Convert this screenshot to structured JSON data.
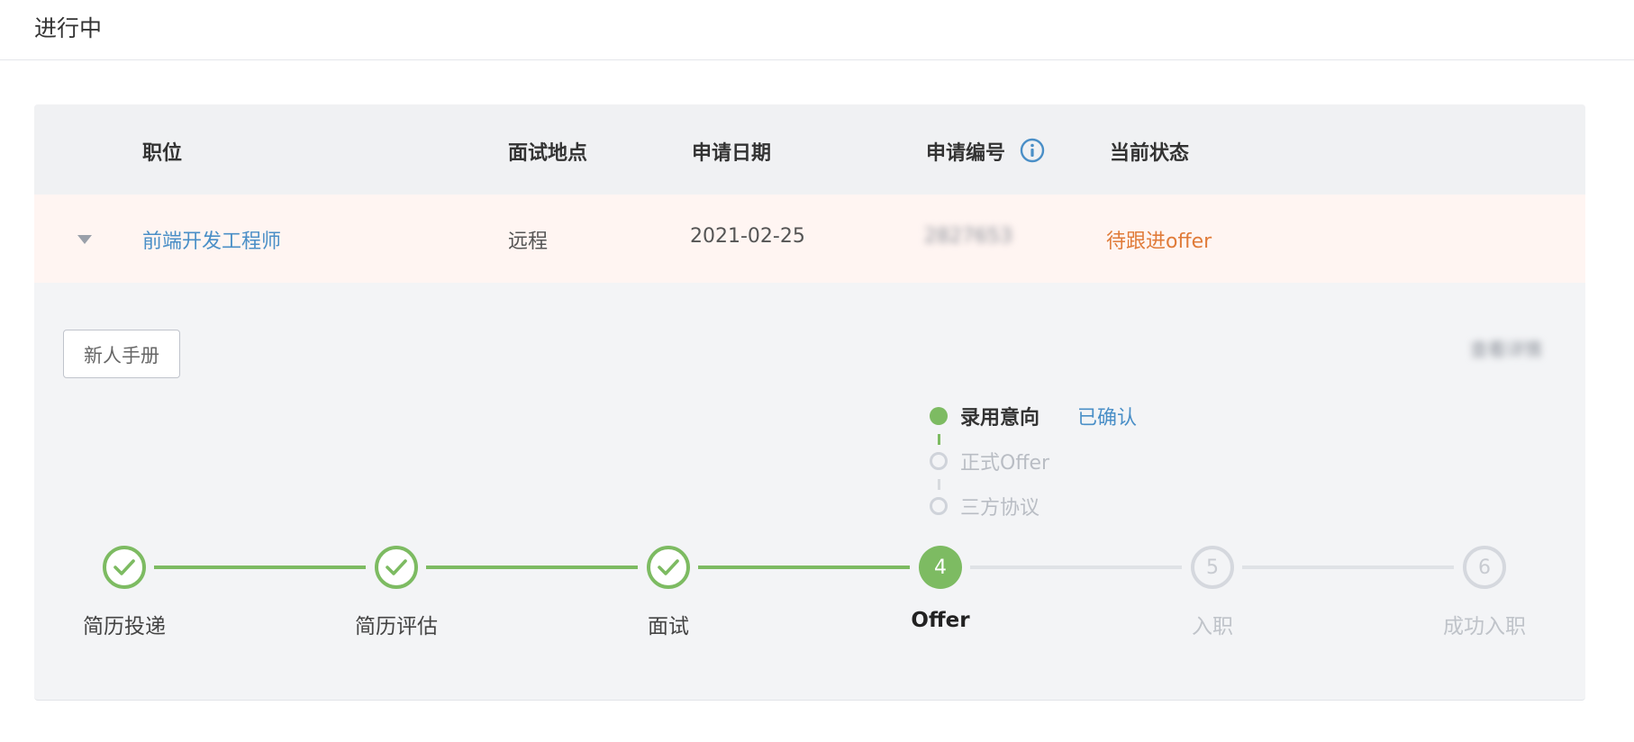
{
  "page": {
    "title": "进行中"
  },
  "table": {
    "headers": {
      "position": "职位",
      "location": "面试地点",
      "apply_date": "申请日期",
      "apply_id": "申请编号",
      "status": "当前状态"
    },
    "row": {
      "position": "前端开发工程师",
      "location": "远程",
      "apply_date": "2021-02-25",
      "apply_id": "2827653",
      "status": "待跟进offer"
    }
  },
  "detail": {
    "handbook_button": "新人手册",
    "right_link": "查看详情",
    "offer_substeps": [
      {
        "label": "录用意向",
        "state": "已确认",
        "active": true
      },
      {
        "label": "正式Offer",
        "active": false
      },
      {
        "label": "三方协议",
        "active": false
      }
    ],
    "steps": [
      {
        "number": "1",
        "label": "简历投递",
        "status": "done"
      },
      {
        "number": "2",
        "label": "简历评估",
        "status": "done"
      },
      {
        "number": "3",
        "label": "面试",
        "status": "done"
      },
      {
        "number": "4",
        "label": "Offer",
        "status": "current"
      },
      {
        "number": "5",
        "label": "入职",
        "status": "todo"
      },
      {
        "number": "6",
        "label": "成功入职",
        "status": "todo"
      }
    ]
  },
  "colors": {
    "accent_green": "#7dbb62",
    "link_blue": "#4a8fc7",
    "status_orange": "#e07b39",
    "row_highlight": "#fff5f2"
  },
  "icons": {
    "expand": "caret-down-icon",
    "info": "info-circle-icon",
    "done_step": "check-icon"
  }
}
